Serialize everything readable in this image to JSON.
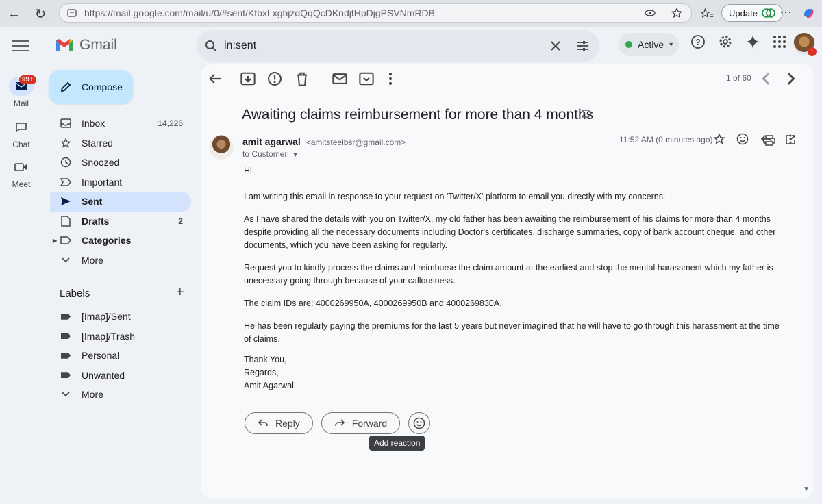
{
  "browser": {
    "url": "https://mail.google.com/mail/u/0/#sent/KtbxLxghjzdQqQcDKndjtHpDjgPSVNmRDB",
    "update_label": "Update"
  },
  "gmail": {
    "logo_text": "Gmail",
    "search_query": "in:sent",
    "status_label": "Active"
  },
  "rail": {
    "mail_label": "Mail",
    "mail_badge": "99+",
    "chat_label": "Chat",
    "meet_label": "Meet"
  },
  "sidebar": {
    "compose_label": "Compose",
    "items": [
      {
        "label": "Inbox",
        "count": "14,226",
        "icon": "inbox-icon"
      },
      {
        "label": "Starred",
        "count": "",
        "icon": "star-icon"
      },
      {
        "label": "Snoozed",
        "count": "",
        "icon": "clock-icon"
      },
      {
        "label": "Important",
        "count": "",
        "icon": "important-icon"
      },
      {
        "label": "Sent",
        "count": "",
        "icon": "send-icon"
      },
      {
        "label": "Drafts",
        "count": "2",
        "icon": "draft-icon"
      },
      {
        "label": "Categories",
        "count": "",
        "icon": "label-icon"
      },
      {
        "label": "More",
        "count": "",
        "icon": "chevron-down-icon"
      }
    ],
    "labels_heading": "Labels",
    "labels": [
      {
        "label": "[Imap]/Sent"
      },
      {
        "label": "[Imap]/Trash"
      },
      {
        "label": "Personal"
      },
      {
        "label": "Unwanted"
      }
    ],
    "labels_more": "More"
  },
  "message": {
    "pager": "1 of 60",
    "subject": "Awaiting claims reimbursement for more than 4 months",
    "sender_name": "amit agarwal",
    "sender_email": "<amitsteelbsr@gmail.com>",
    "to_line": "to Customer",
    "time": "11:52 AM (0 minutes ago)",
    "greeting": "Hi,",
    "para1": "I am writing this email in response to your request on 'Twitter/X' platform to email you directly with my concerns.",
    "para2": "As I have shared the details with you on Twitter/X, my old father has been awaiting the reimbursement of his claims for more than 4 months despite providing all the necessary documents including Doctor's certificates, discharge summaries, copy of bank account cheque, and other documents, which you have been asking for regularly.",
    "para3": "Request you to kindly process the claims and reimburse the claim amount at the earliest and stop the mental harassment which my father is unecessary going through because of your callousness.",
    "para4": "The claim IDs are: 4000269950A, 4000269950B and 4000269830A.",
    "para5": "He has been regularly paying the premiums for the last 5 years but never imagined that he will have to go through this harassment at the time of claims.",
    "sign1": "Thank You,",
    "sign2": "Regards,",
    "sign3": "Amit Agarwal",
    "reply_label": "Reply",
    "forward_label": "Forward",
    "tooltip": "Add reaction"
  }
}
